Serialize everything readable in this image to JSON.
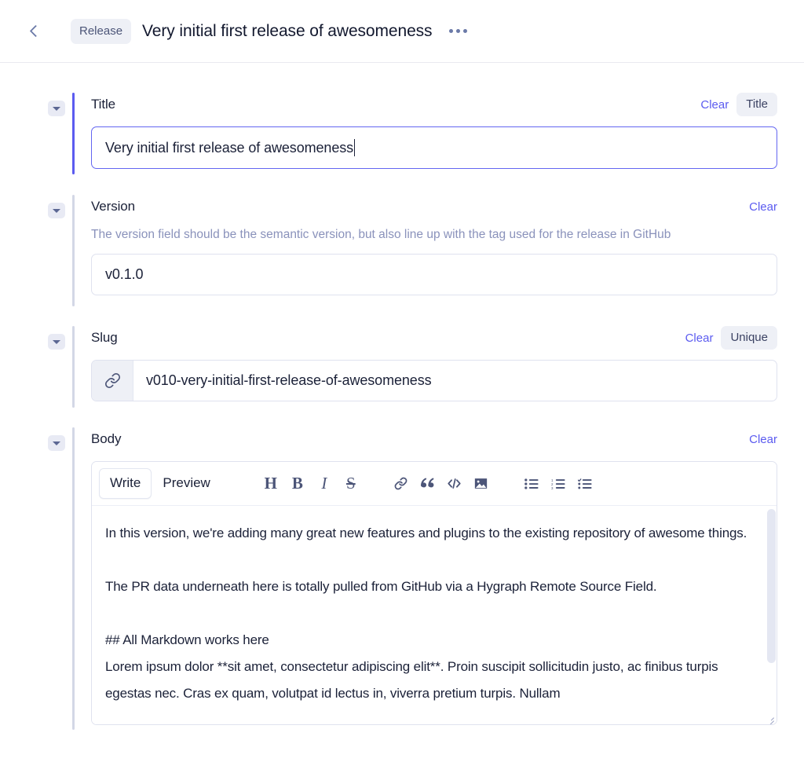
{
  "header": {
    "back_icon": "chevron-left-icon",
    "breadcrumb_type": "Release",
    "title": "Very initial first release of awesomeness",
    "more_icon": "ellipsis-icon"
  },
  "colors": {
    "accent_focused": "#5b5bf0",
    "accent_idle": "#d3d7e6",
    "link": "#5b5bf0",
    "pill_bg": "#eef0f6",
    "desc_text": "#8a92bb",
    "text": "#1b2138"
  },
  "fields": {
    "title": {
      "label": "Title",
      "clear_label": "Clear",
      "tag_label": "Title",
      "value": "Very initial first release of awesomeness",
      "focused": true
    },
    "version": {
      "label": "Version",
      "clear_label": "Clear",
      "description": "The version field should be the semantic version, but also line up with the tag used for the release in GitHub",
      "value": "v0.1.0",
      "focused": false
    },
    "slug": {
      "label": "Slug",
      "clear_label": "Clear",
      "tag_label": "Unique",
      "icon": "link-icon",
      "value": "v010-very-initial-first-release-of-awesomeness",
      "focused": false
    },
    "body": {
      "label": "Body",
      "clear_label": "Clear",
      "tabs": [
        {
          "label": "Write",
          "active": true
        },
        {
          "label": "Preview",
          "active": false
        }
      ],
      "tools": [
        {
          "name": "heading-icon",
          "glyph": "H"
        },
        {
          "name": "bold-icon",
          "glyph": "B"
        },
        {
          "name": "italic-icon",
          "glyph": "I"
        },
        {
          "name": "strikethrough-icon",
          "glyph": "S"
        },
        {
          "name": "link-icon",
          "glyph": ""
        },
        {
          "name": "quote-icon",
          "glyph": "”"
        },
        {
          "name": "code-icon",
          "glyph": "</>"
        },
        {
          "name": "image-icon",
          "glyph": ""
        },
        {
          "name": "bulleted-list-icon",
          "glyph": ""
        },
        {
          "name": "numbered-list-icon",
          "glyph": ""
        },
        {
          "name": "checklist-icon",
          "glyph": ""
        }
      ],
      "value": "In this version, we're adding many great new features and plugins to the existing repository of awesome things.\n\nThe PR data underneath here is totally pulled from GitHub via a Hygraph Remote Source Field.\n\n## All Markdown works here\nLorem ipsum dolor **sit amet, consectetur adipiscing elit**. Proin suscipit sollicitudin justo, ac finibus turpis egestas nec. Cras ex quam, volutpat id lectus in, viverra pretium turpis. Nullam",
      "focused": false
    }
  },
  "collapse_icon": "caret-down-icon"
}
